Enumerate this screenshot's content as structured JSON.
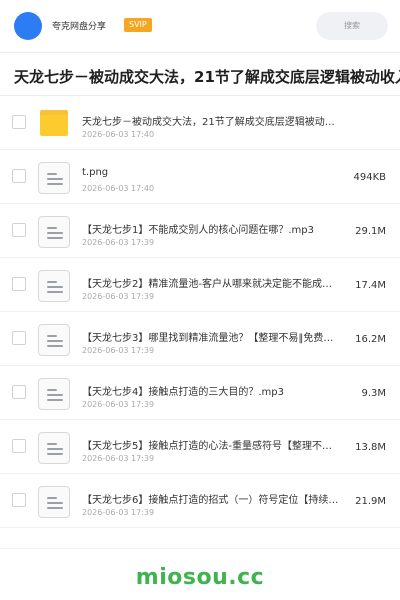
{
  "header": {
    "brand": "夸克网盘分享",
    "badge": "SVIP",
    "search_label": "搜索"
  },
  "title": "天龙七步－被动成交大法，21节了解成交底层逻辑被动收入",
  "files": [
    {
      "type": "folder-icon",
      "name": "天龙七步－被动成交大法，21节了解成交底层逻辑被动…",
      "date": "2026-06-03 17:40",
      "size": ""
    },
    {
      "type": "file-icon",
      "name": "t.png",
      "date": "2026-06-03 17:40",
      "size": "494KB"
    },
    {
      "type": "file-icon",
      "name": "【天龙七步1】不能成交别人的核心问题在哪？.mp3",
      "date": "2026-06-03 17:39",
      "size": "29.1M"
    },
    {
      "type": "file-icon",
      "name": "【天龙七步2】精准流量池-客户从哪来就决定能不能成…",
      "date": "2026-06-03 17:39",
      "size": "17.4M"
    },
    {
      "type": "file-icon",
      "name": "【天龙七步3】哪里找到精准流量池？【整理不易‖免费…",
      "date": "2026-06-03 17:39",
      "size": "16.2M"
    },
    {
      "type": "file-icon",
      "name": "【天龙七步4】接触点打造的三大目的？.mp3",
      "date": "2026-06-03 17:39",
      "size": "9.3M"
    },
    {
      "type": "file-icon",
      "name": "【天龙七步5】接触点打造的心法-重量感符号【整理不…",
      "date": "2026-06-03 17:39",
      "size": "13.8M"
    },
    {
      "type": "file-icon",
      "name": "【天龙七步6】接触点打造的招式（一）符号定位【持续…",
      "date": "2026-06-03 17:39",
      "size": "21.9M"
    }
  ],
  "footer": {
    "logo": "miosou.cc"
  }
}
